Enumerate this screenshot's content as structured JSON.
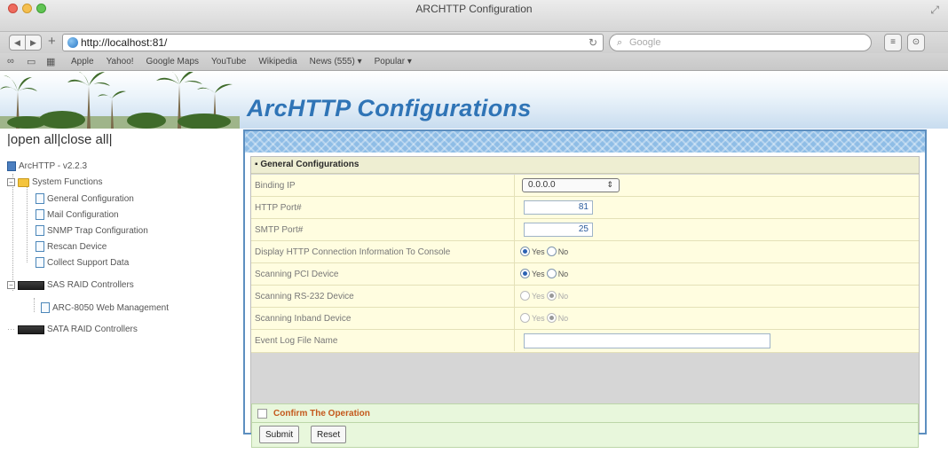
{
  "browser": {
    "window_title": "ARCHTTP Configuration",
    "url": "http://localhost:81/",
    "search_placeholder": "Google",
    "bookmarks": [
      "Apple",
      "Yahoo!",
      "Google Maps",
      "YouTube",
      "Wikipedia",
      "News (555) ▾",
      "Popular ▾"
    ]
  },
  "page": {
    "banner_title": "ArcHTTP Configurations",
    "open_all": "open all",
    "close_all": "close all"
  },
  "tree": {
    "root": "ArcHTTP - v2.2.3",
    "system_functions": "System Functions",
    "items": [
      "General Configuration",
      "Mail Configuration",
      "SNMP Trap Configuration",
      "Rescan Device",
      "Collect Support Data"
    ],
    "sas": "SAS RAID Controllers",
    "sas_items": [
      "ARC-8050 Web Management"
    ],
    "sata": "SATA RAID Controllers"
  },
  "form": {
    "header": "General Configurations",
    "binding_ip_label": "Binding IP",
    "binding_ip_value": "0.0.0.0",
    "http_port_label": "HTTP Port#",
    "http_port_value": "81",
    "smtp_port_label": "SMTP Port#",
    "smtp_port_value": "25",
    "display_http_label": "Display HTTP Connection Information To Console",
    "display_http_value": "Yes",
    "scan_pci_label": "Scanning PCI Device",
    "scan_pci_value": "Yes",
    "scan_rs232_label": "Scanning RS-232 Device",
    "scan_rs232_value": "No",
    "scan_inband_label": "Scanning Inband Device",
    "scan_inband_value": "No",
    "event_log_label": "Event Log File Name",
    "event_log_value": "",
    "yes": "Yes",
    "no": "No",
    "confirm_label": "Confirm The Operation",
    "submit": "Submit",
    "reset": "Reset"
  },
  "colors": {
    "banner_title": "#2f74b6",
    "confirm_text": "#c4581c",
    "form_row": "#fffde0",
    "confirm_row": "#e8f7dc"
  }
}
